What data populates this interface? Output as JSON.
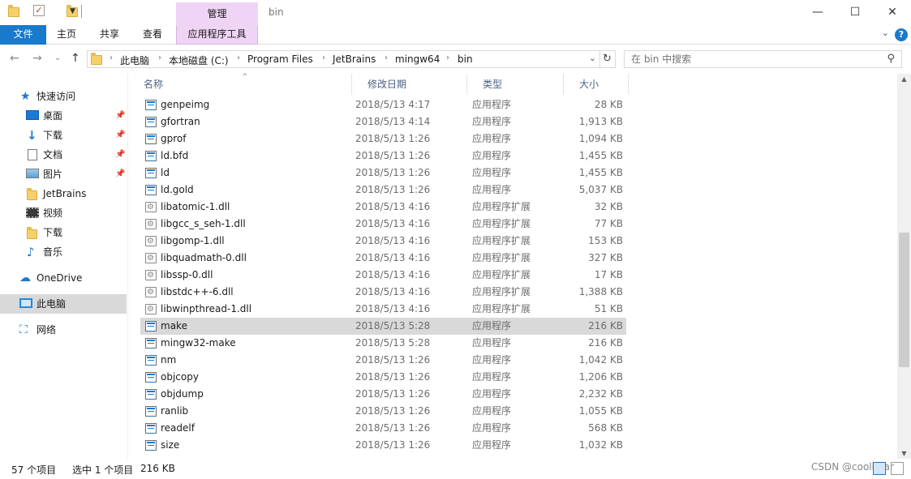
{
  "window": {
    "title": "bin",
    "context_tab": "管理",
    "controls": {
      "minimize": "—",
      "maximize": "☐",
      "close": "✕"
    }
  },
  "ribbon": {
    "tabs": [
      "文件",
      "主页",
      "共享",
      "查看",
      "应用程序工具"
    ],
    "collapse": "⌄",
    "help": "?"
  },
  "address": {
    "back": "←",
    "forward": "→",
    "recent": "⌄",
    "up": "↑",
    "crumbs": [
      "此电脑",
      "本地磁盘 (C:)",
      "Program Files",
      "JetBrains",
      "mingw64",
      "bin"
    ],
    "separator": "›",
    "dropdown": "⌄",
    "refresh": "↻"
  },
  "search": {
    "placeholder": "在 bin 中搜索",
    "icon": "⚲"
  },
  "sidebar": {
    "items": [
      {
        "label": "快速访问",
        "icon": "star-icon",
        "glyph": "★"
      },
      {
        "label": "桌面",
        "icon": "desktop-icon",
        "pinned": true
      },
      {
        "label": "下载",
        "icon": "download-icon",
        "glyph": "↓",
        "pinned": true
      },
      {
        "label": "文档",
        "icon": "document-icon",
        "pinned": true
      },
      {
        "label": "图片",
        "icon": "pictures-icon",
        "pinned": true
      },
      {
        "label": "JetBrains",
        "icon": "folder-icon"
      },
      {
        "label": "视频",
        "icon": "video-icon"
      },
      {
        "label": "下载",
        "icon": "folder-icon"
      },
      {
        "label": "音乐",
        "icon": "music-icon",
        "glyph": "♪"
      },
      {
        "label": "OneDrive",
        "icon": "cloud-icon",
        "glyph": "☁"
      },
      {
        "label": "此电脑",
        "icon": "computer-icon",
        "selected": true
      },
      {
        "label": "网络",
        "icon": "network-icon",
        "glyph": "⛶"
      }
    ],
    "pin_glyph": "📌"
  },
  "columns": {
    "name": "名称",
    "date": "修改日期",
    "type": "类型",
    "size": "大小",
    "sort_glyph": "^"
  },
  "files": [
    {
      "name": "genpeimg",
      "date": "2018/5/13 4:17",
      "type": "应用程序",
      "size": "28 KB",
      "kind": "exe"
    },
    {
      "name": "gfortran",
      "date": "2018/5/13 4:14",
      "type": "应用程序",
      "size": "1,913 KB",
      "kind": "exe"
    },
    {
      "name": "gprof",
      "date": "2018/5/13 1:26",
      "type": "应用程序",
      "size": "1,094 KB",
      "kind": "exe"
    },
    {
      "name": "ld.bfd",
      "date": "2018/5/13 1:26",
      "type": "应用程序",
      "size": "1,455 KB",
      "kind": "exe"
    },
    {
      "name": "ld",
      "date": "2018/5/13 1:26",
      "type": "应用程序",
      "size": "1,455 KB",
      "kind": "exe"
    },
    {
      "name": "ld.gold",
      "date": "2018/5/13 1:26",
      "type": "应用程序",
      "size": "5,037 KB",
      "kind": "exe"
    },
    {
      "name": "libatomic-1.dll",
      "date": "2018/5/13 4:16",
      "type": "应用程序扩展",
      "size": "32 KB",
      "kind": "dll"
    },
    {
      "name": "libgcc_s_seh-1.dll",
      "date": "2018/5/13 4:16",
      "type": "应用程序扩展",
      "size": "77 KB",
      "kind": "dll"
    },
    {
      "name": "libgomp-1.dll",
      "date": "2018/5/13 4:16",
      "type": "应用程序扩展",
      "size": "153 KB",
      "kind": "dll"
    },
    {
      "name": "libquadmath-0.dll",
      "date": "2018/5/13 4:16",
      "type": "应用程序扩展",
      "size": "327 KB",
      "kind": "dll"
    },
    {
      "name": "libssp-0.dll",
      "date": "2018/5/13 4:16",
      "type": "应用程序扩展",
      "size": "17 KB",
      "kind": "dll"
    },
    {
      "name": "libstdc++-6.dll",
      "date": "2018/5/13 4:16",
      "type": "应用程序扩展",
      "size": "1,388 KB",
      "kind": "dll"
    },
    {
      "name": "libwinpthread-1.dll",
      "date": "2018/5/13 4:16",
      "type": "应用程序扩展",
      "size": "51 KB",
      "kind": "dll"
    },
    {
      "name": "make",
      "date": "2018/5/13 5:28",
      "type": "应用程序",
      "size": "216 KB",
      "kind": "exe",
      "selected": true
    },
    {
      "name": "mingw32-make",
      "date": "2018/5/13 5:28",
      "type": "应用程序",
      "size": "216 KB",
      "kind": "exe"
    },
    {
      "name": "nm",
      "date": "2018/5/13 1:26",
      "type": "应用程序",
      "size": "1,042 KB",
      "kind": "exe"
    },
    {
      "name": "objcopy",
      "date": "2018/5/13 1:26",
      "type": "应用程序",
      "size": "1,206 KB",
      "kind": "exe"
    },
    {
      "name": "objdump",
      "date": "2018/5/13 1:26",
      "type": "应用程序",
      "size": "2,232 KB",
      "kind": "exe"
    },
    {
      "name": "ranlib",
      "date": "2018/5/13 1:26",
      "type": "应用程序",
      "size": "1,055 KB",
      "kind": "exe"
    },
    {
      "name": "readelf",
      "date": "2018/5/13 1:26",
      "type": "应用程序",
      "size": "568 KB",
      "kind": "exe"
    },
    {
      "name": "size",
      "date": "2018/5/13 1:26",
      "type": "应用程序",
      "size": "1,032 KB",
      "kind": "exe"
    }
  ],
  "scrollbar": {
    "up": "▲",
    "down": "▼"
  },
  "status": {
    "count": "57 个项目",
    "selection": "选中 1 个项目",
    "selection_size": "216 KB"
  },
  "watermark": "CSDN @coolbear",
  "colors": {
    "accent": "#1979ca",
    "context_tab": "#f0d4f5",
    "selected_row": "#d9d9d9"
  }
}
